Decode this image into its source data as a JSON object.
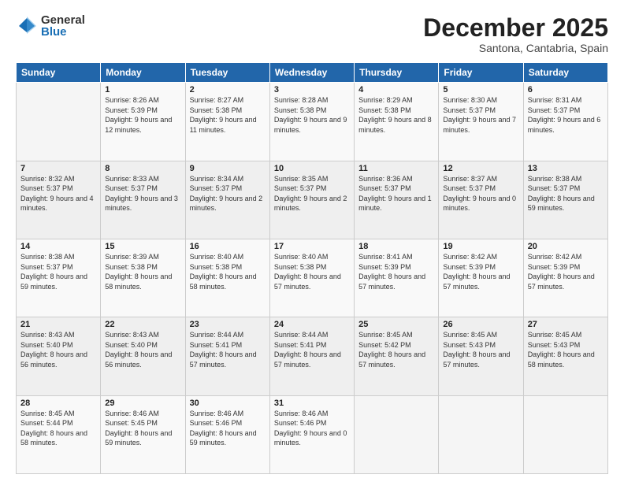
{
  "logo": {
    "general": "General",
    "blue": "Blue"
  },
  "title": "December 2025",
  "subtitle": "Santona, Cantabria, Spain",
  "header_days": [
    "Sunday",
    "Monday",
    "Tuesday",
    "Wednesday",
    "Thursday",
    "Friday",
    "Saturday"
  ],
  "weeks": [
    [
      {
        "day": "",
        "sunrise": "",
        "sunset": "",
        "daylight": ""
      },
      {
        "day": "1",
        "sunrise": "Sunrise: 8:26 AM",
        "sunset": "Sunset: 5:39 PM",
        "daylight": "Daylight: 9 hours and 12 minutes."
      },
      {
        "day": "2",
        "sunrise": "Sunrise: 8:27 AM",
        "sunset": "Sunset: 5:38 PM",
        "daylight": "Daylight: 9 hours and 11 minutes."
      },
      {
        "day": "3",
        "sunrise": "Sunrise: 8:28 AM",
        "sunset": "Sunset: 5:38 PM",
        "daylight": "Daylight: 9 hours and 9 minutes."
      },
      {
        "day": "4",
        "sunrise": "Sunrise: 8:29 AM",
        "sunset": "Sunset: 5:38 PM",
        "daylight": "Daylight: 9 hours and 8 minutes."
      },
      {
        "day": "5",
        "sunrise": "Sunrise: 8:30 AM",
        "sunset": "Sunset: 5:37 PM",
        "daylight": "Daylight: 9 hours and 7 minutes."
      },
      {
        "day": "6",
        "sunrise": "Sunrise: 8:31 AM",
        "sunset": "Sunset: 5:37 PM",
        "daylight": "Daylight: 9 hours and 6 minutes."
      }
    ],
    [
      {
        "day": "7",
        "sunrise": "Sunrise: 8:32 AM",
        "sunset": "Sunset: 5:37 PM",
        "daylight": "Daylight: 9 hours and 4 minutes."
      },
      {
        "day": "8",
        "sunrise": "Sunrise: 8:33 AM",
        "sunset": "Sunset: 5:37 PM",
        "daylight": "Daylight: 9 hours and 3 minutes."
      },
      {
        "day": "9",
        "sunrise": "Sunrise: 8:34 AM",
        "sunset": "Sunset: 5:37 PM",
        "daylight": "Daylight: 9 hours and 2 minutes."
      },
      {
        "day": "10",
        "sunrise": "Sunrise: 8:35 AM",
        "sunset": "Sunset: 5:37 PM",
        "daylight": "Daylight: 9 hours and 2 minutes."
      },
      {
        "day": "11",
        "sunrise": "Sunrise: 8:36 AM",
        "sunset": "Sunset: 5:37 PM",
        "daylight": "Daylight: 9 hours and 1 minute."
      },
      {
        "day": "12",
        "sunrise": "Sunrise: 8:37 AM",
        "sunset": "Sunset: 5:37 PM",
        "daylight": "Daylight: 9 hours and 0 minutes."
      },
      {
        "day": "13",
        "sunrise": "Sunrise: 8:38 AM",
        "sunset": "Sunset: 5:37 PM",
        "daylight": "Daylight: 8 hours and 59 minutes."
      }
    ],
    [
      {
        "day": "14",
        "sunrise": "Sunrise: 8:38 AM",
        "sunset": "Sunset: 5:37 PM",
        "daylight": "Daylight: 8 hours and 59 minutes."
      },
      {
        "day": "15",
        "sunrise": "Sunrise: 8:39 AM",
        "sunset": "Sunset: 5:38 PM",
        "daylight": "Daylight: 8 hours and 58 minutes."
      },
      {
        "day": "16",
        "sunrise": "Sunrise: 8:40 AM",
        "sunset": "Sunset: 5:38 PM",
        "daylight": "Daylight: 8 hours and 58 minutes."
      },
      {
        "day": "17",
        "sunrise": "Sunrise: 8:40 AM",
        "sunset": "Sunset: 5:38 PM",
        "daylight": "Daylight: 8 hours and 57 minutes."
      },
      {
        "day": "18",
        "sunrise": "Sunrise: 8:41 AM",
        "sunset": "Sunset: 5:39 PM",
        "daylight": "Daylight: 8 hours and 57 minutes."
      },
      {
        "day": "19",
        "sunrise": "Sunrise: 8:42 AM",
        "sunset": "Sunset: 5:39 PM",
        "daylight": "Daylight: 8 hours and 57 minutes."
      },
      {
        "day": "20",
        "sunrise": "Sunrise: 8:42 AM",
        "sunset": "Sunset: 5:39 PM",
        "daylight": "Daylight: 8 hours and 57 minutes."
      }
    ],
    [
      {
        "day": "21",
        "sunrise": "Sunrise: 8:43 AM",
        "sunset": "Sunset: 5:40 PM",
        "daylight": "Daylight: 8 hours and 56 minutes."
      },
      {
        "day": "22",
        "sunrise": "Sunrise: 8:43 AM",
        "sunset": "Sunset: 5:40 PM",
        "daylight": "Daylight: 8 hours and 56 minutes."
      },
      {
        "day": "23",
        "sunrise": "Sunrise: 8:44 AM",
        "sunset": "Sunset: 5:41 PM",
        "daylight": "Daylight: 8 hours and 57 minutes."
      },
      {
        "day": "24",
        "sunrise": "Sunrise: 8:44 AM",
        "sunset": "Sunset: 5:41 PM",
        "daylight": "Daylight: 8 hours and 57 minutes."
      },
      {
        "day": "25",
        "sunrise": "Sunrise: 8:45 AM",
        "sunset": "Sunset: 5:42 PM",
        "daylight": "Daylight: 8 hours and 57 minutes."
      },
      {
        "day": "26",
        "sunrise": "Sunrise: 8:45 AM",
        "sunset": "Sunset: 5:43 PM",
        "daylight": "Daylight: 8 hours and 57 minutes."
      },
      {
        "day": "27",
        "sunrise": "Sunrise: 8:45 AM",
        "sunset": "Sunset: 5:43 PM",
        "daylight": "Daylight: 8 hours and 58 minutes."
      }
    ],
    [
      {
        "day": "28",
        "sunrise": "Sunrise: 8:45 AM",
        "sunset": "Sunset: 5:44 PM",
        "daylight": "Daylight: 8 hours and 58 minutes."
      },
      {
        "day": "29",
        "sunrise": "Sunrise: 8:46 AM",
        "sunset": "Sunset: 5:45 PM",
        "daylight": "Daylight: 8 hours and 59 minutes."
      },
      {
        "day": "30",
        "sunrise": "Sunrise: 8:46 AM",
        "sunset": "Sunset: 5:46 PM",
        "daylight": "Daylight: 8 hours and 59 minutes."
      },
      {
        "day": "31",
        "sunrise": "Sunrise: 8:46 AM",
        "sunset": "Sunset: 5:46 PM",
        "daylight": "Daylight: 9 hours and 0 minutes."
      },
      {
        "day": "",
        "sunrise": "",
        "sunset": "",
        "daylight": ""
      },
      {
        "day": "",
        "sunrise": "",
        "sunset": "",
        "daylight": ""
      },
      {
        "day": "",
        "sunrise": "",
        "sunset": "",
        "daylight": ""
      }
    ]
  ]
}
